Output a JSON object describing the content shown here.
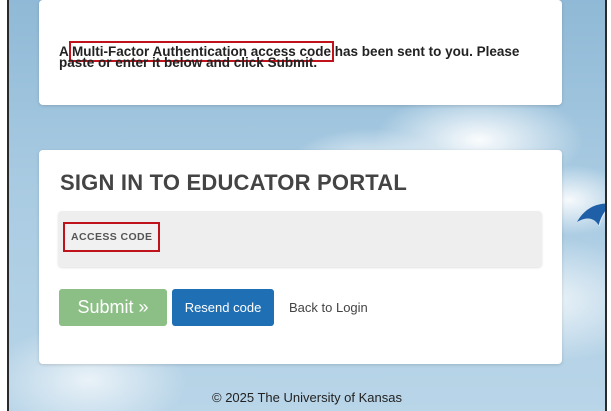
{
  "mfa_message": {
    "prefix": "A ",
    "highlight": "Multi-Factor Authentication access code",
    "suffix": " has been sent to you. Please",
    "line2_text": "paste or enter it below and click ",
    "line2_bold": "Submit",
    "line2_end": "."
  },
  "login": {
    "heading": "SIGN IN TO EDUCATOR PORTAL",
    "access_code_label": "ACCESS CODE",
    "submit_label": "Submit »",
    "resend_label": "Resend code",
    "back_link": "Back to Login"
  },
  "footer": {
    "copyright": "© 2025 The University of Kansas"
  },
  "colors": {
    "submit_button": "#8cbf86",
    "resend_button": "#1f6fb5",
    "highlight_outline": "#c0121a"
  },
  "icons": {
    "kite": "kite-icon"
  }
}
